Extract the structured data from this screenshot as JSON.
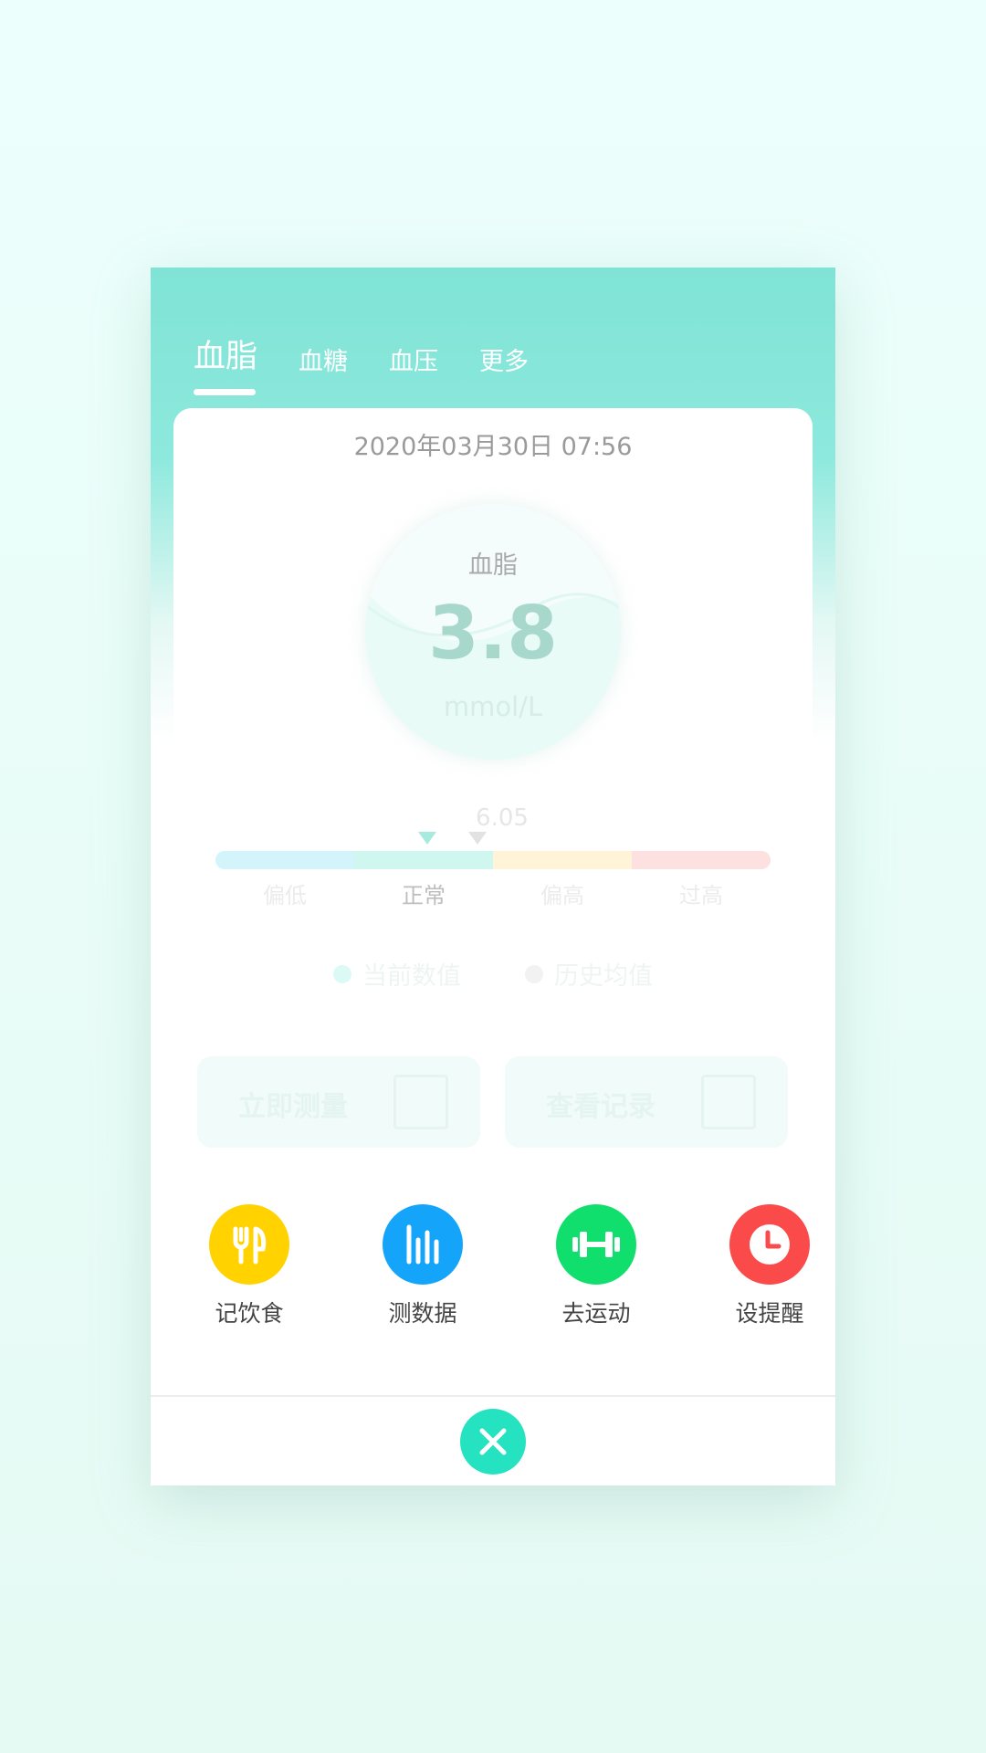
{
  "tabs": [
    {
      "label": "血脂",
      "active": true
    },
    {
      "label": "血糖",
      "active": false
    },
    {
      "label": "血压",
      "active": false
    },
    {
      "label": "更多",
      "active": false
    }
  ],
  "record": {
    "datetime": "2020年03月30日 07:56",
    "gauge_title": "血脂",
    "value": "3.8",
    "unit": "mmol/L",
    "reference_value": "6.05"
  },
  "scale": {
    "labels": [
      "偏低",
      "正常",
      "偏高",
      "过高"
    ],
    "colors": [
      "#d3f4fb",
      "#cff7ef",
      "#fff3d8",
      "#fde0e0"
    ],
    "current_level": "正常"
  },
  "legend": {
    "current": "当前数值",
    "history": "历史均值",
    "current_color": "#dcfaf5",
    "history_color": "#f2f2f2"
  },
  "actions": {
    "measure": "立即测量",
    "records": "查看记录"
  },
  "quick_actions": [
    {
      "label": "记饮食",
      "icon": "fork-knife-icon",
      "color": "#ffd200"
    },
    {
      "label": "测数据",
      "icon": "bars-chart-icon",
      "color": "#14a5fb"
    },
    {
      "label": "去运动",
      "icon": "dumbbell-icon",
      "color": "#10df6e"
    },
    {
      "label": "设提醒",
      "icon": "clock-icon",
      "color": "#fb4a4a"
    }
  ],
  "close_color": "#25e3c1"
}
